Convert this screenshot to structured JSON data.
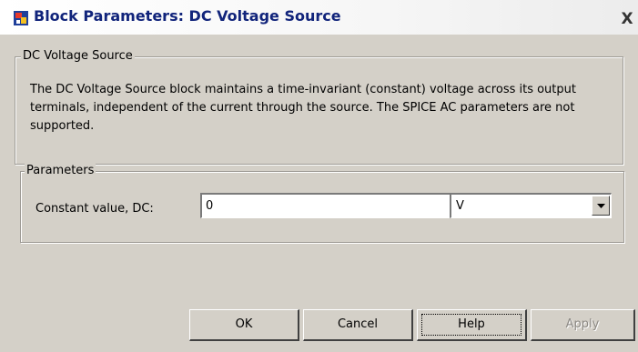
{
  "window": {
    "title": "Block Parameters: DC Voltage Source",
    "close_symbol": "X",
    "icon": "simulink-block-icon"
  },
  "description_group": {
    "legend": "DC Voltage Source",
    "text": "The DC Voltage Source block maintains a time-invariant (constant) voltage across its output terminals, independent of the current through the source. The SPICE AC parameters are not supported."
  },
  "parameters_group": {
    "legend": "Parameters",
    "constant_label": "Constant value, DC:",
    "constant_value": "0",
    "unit_value": "V",
    "dropdown_icon": "chevron-down-icon"
  },
  "buttons": {
    "ok": "OK",
    "cancel": "Cancel",
    "help": "Help",
    "apply": "Apply"
  },
  "colors": {
    "title_text": "#11247b",
    "dialog_bg": "#d4d0c8",
    "disabled_text": "#8d8a85"
  }
}
